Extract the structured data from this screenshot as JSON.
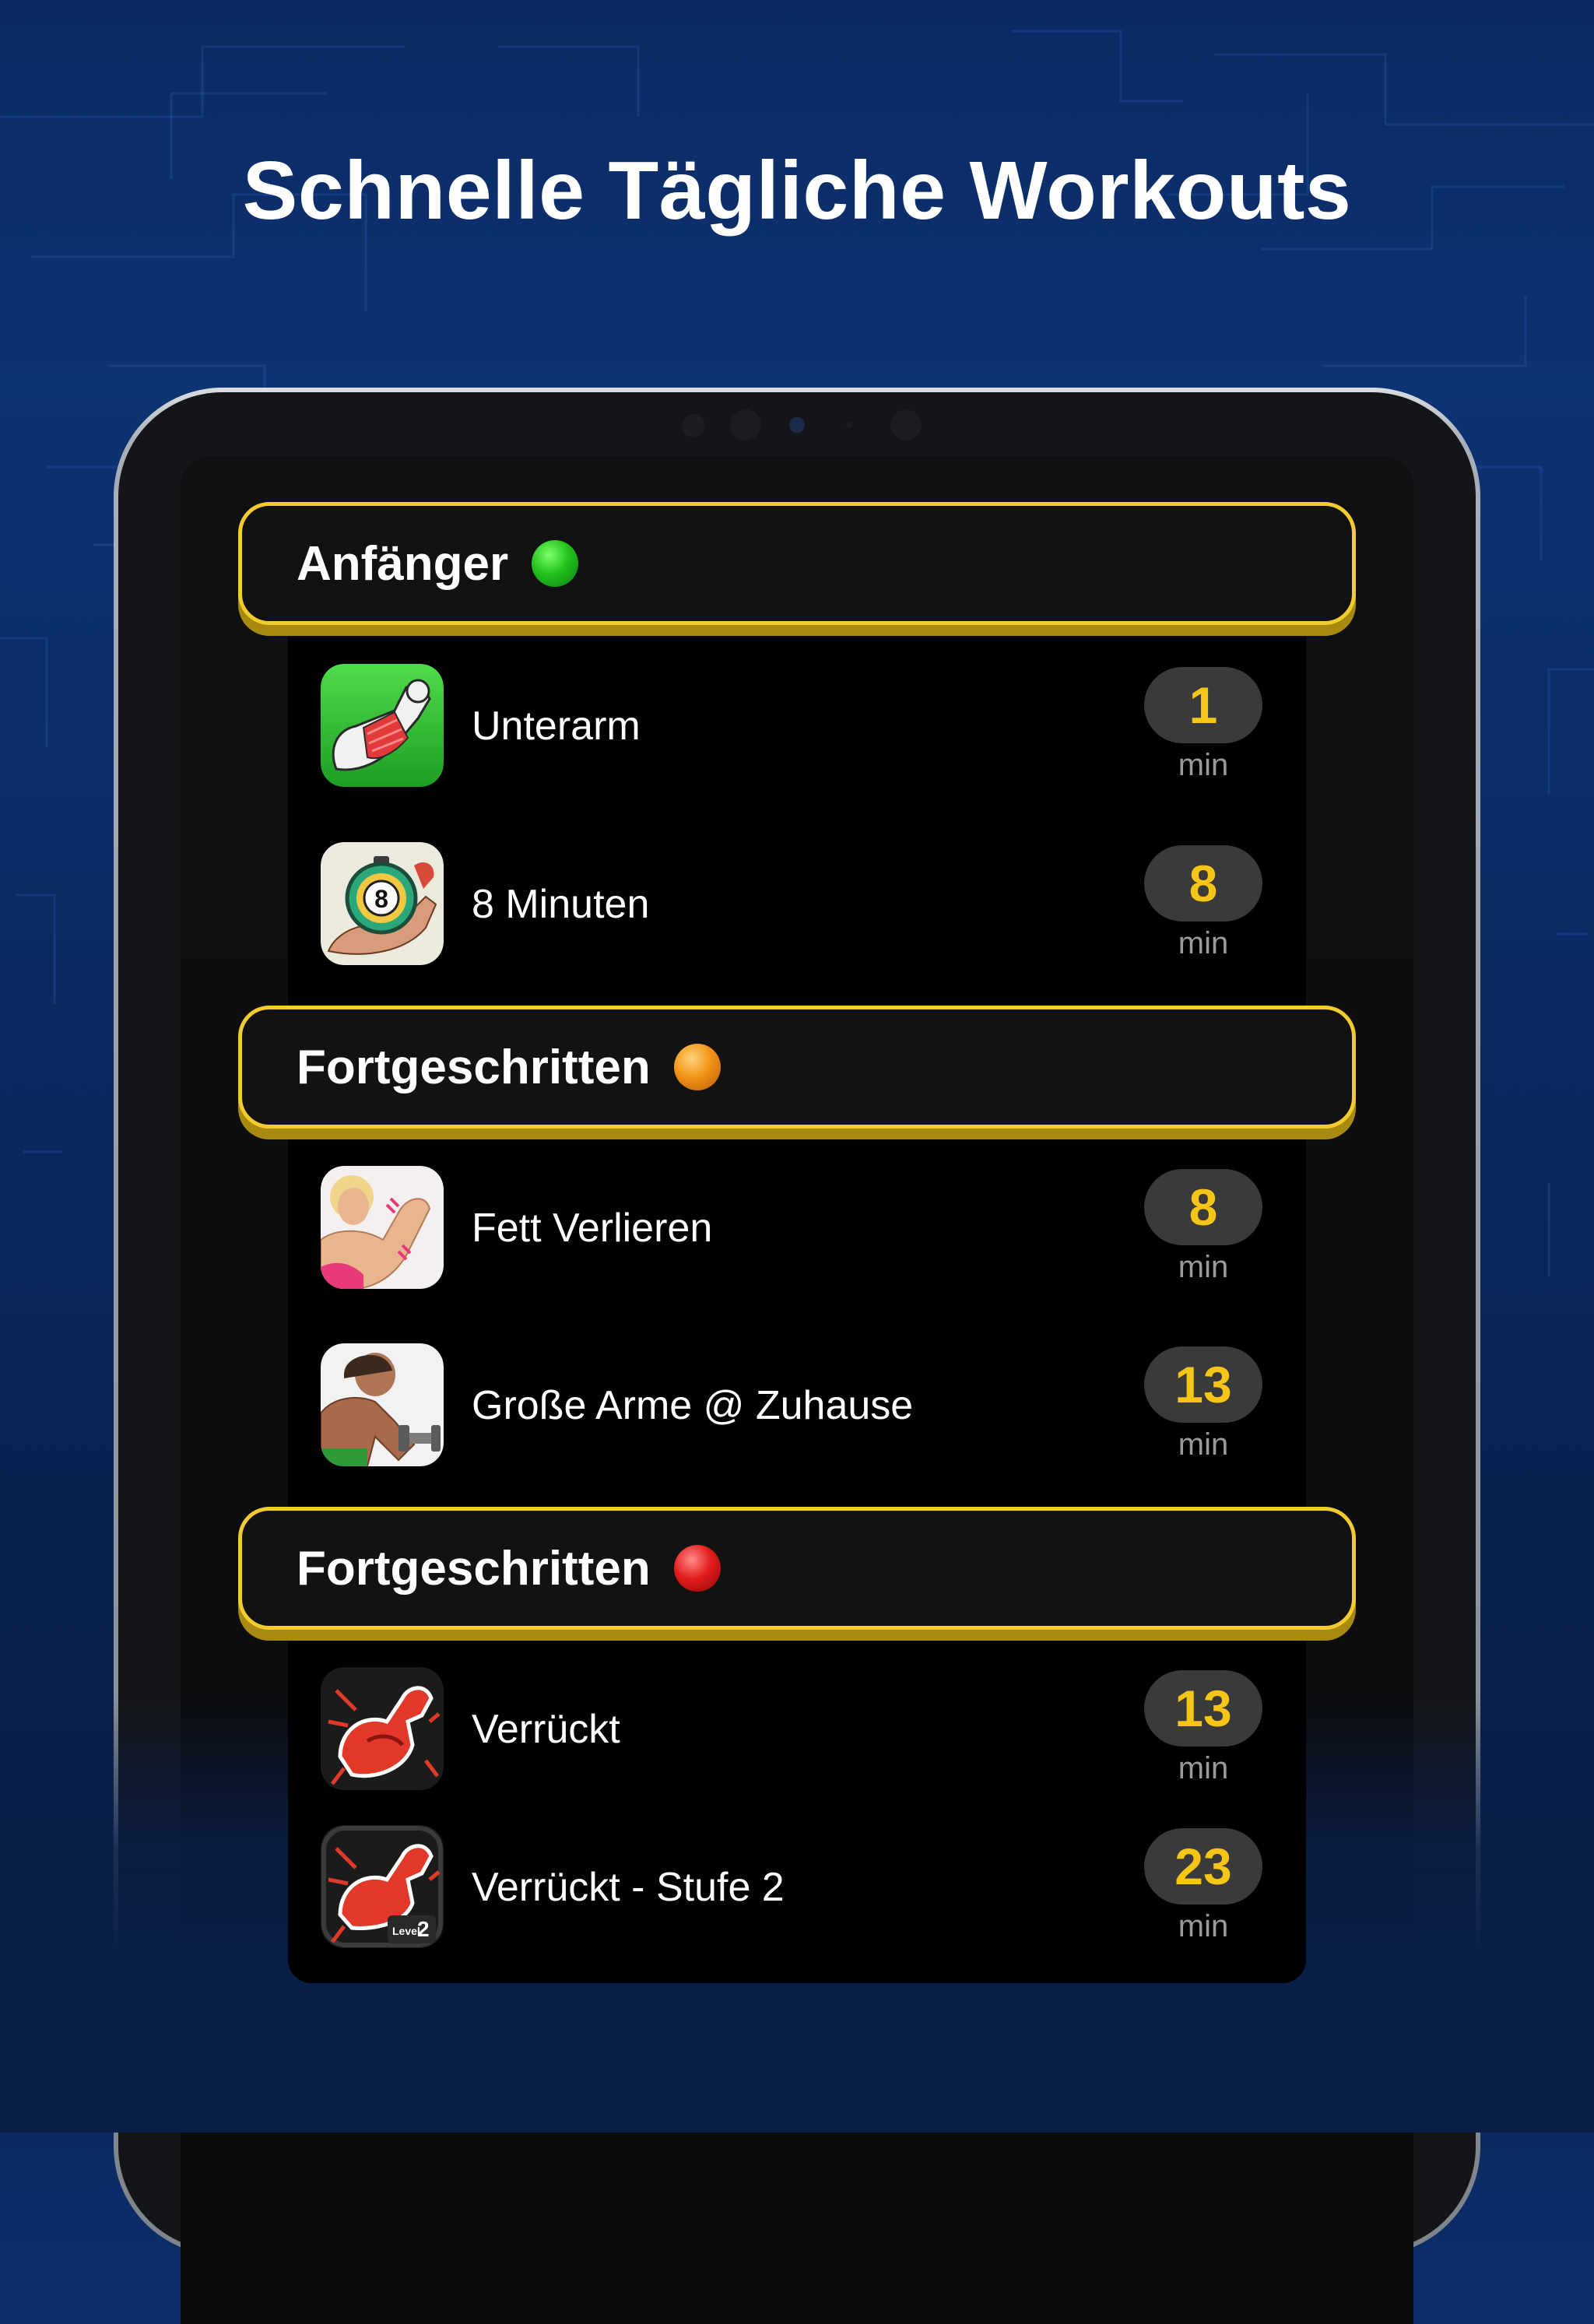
{
  "headline": "Schnelle Tägliche Workouts",
  "colors": {
    "accent_yellow": "#f2cb2e",
    "value_yellow": "#f5c518",
    "background_blue": "#0b2a63",
    "pill_gray": "#3a3a3a"
  },
  "sections": [
    {
      "label": "Anfänger",
      "dot_color": "green",
      "items": [
        {
          "name": "Unterarm",
          "value": "1",
          "unit": "min",
          "icon": "forearm-flex-icon"
        },
        {
          "name": "8 Minuten",
          "value": "8",
          "unit": "min",
          "icon": "stopwatch-arm-icon"
        }
      ]
    },
    {
      "label": "Fortgeschritten",
      "dot_color": "orange",
      "items": [
        {
          "name": "Fett Verlieren",
          "value": "8",
          "unit": "min",
          "icon": "woman-arm-icon"
        },
        {
          "name": "Große Arme @ Zuhause",
          "value": "13",
          "unit": "min",
          "icon": "man-dumbbell-icon"
        }
      ]
    },
    {
      "label": "Fortgeschritten",
      "dot_color": "red",
      "items": [
        {
          "name": "Verrückt",
          "value": "13",
          "unit": "min",
          "icon": "red-flex-arm-icon"
        },
        {
          "name": "Verrückt - Stufe 2",
          "value": "23",
          "unit": "min",
          "icon": "red-flex-arm-level2-icon",
          "badge": "Level",
          "badge_number": "2"
        }
      ]
    }
  ]
}
